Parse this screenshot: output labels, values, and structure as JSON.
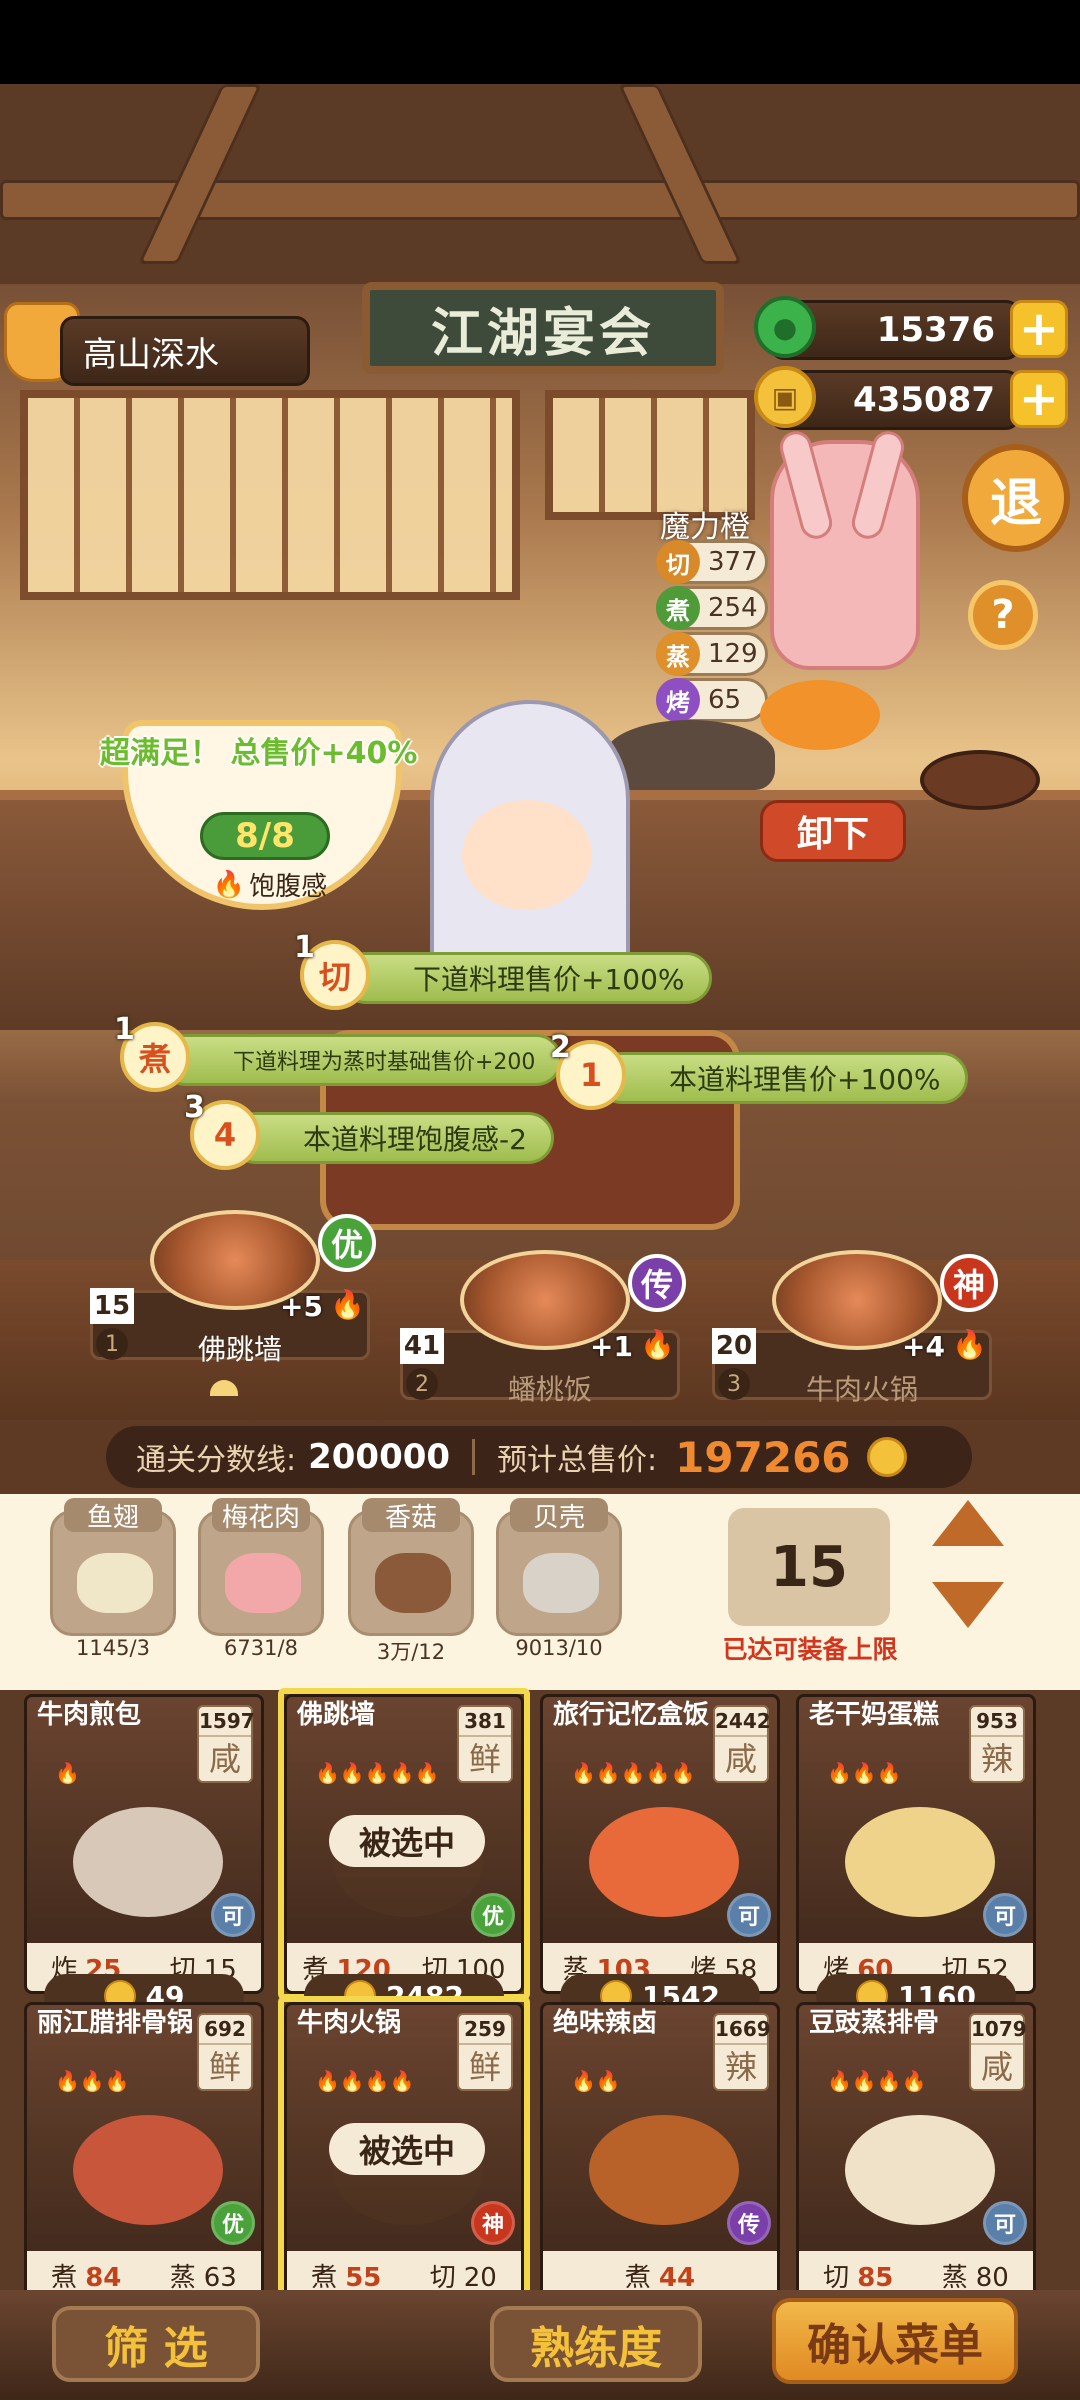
{
  "header": {
    "player_name": "高山深水",
    "sign": "江湖宴会"
  },
  "currency": {
    "jade": "15376",
    "coins": "435087",
    "plus": "+",
    "exit_label": "退",
    "help_label": "?"
  },
  "chef": {
    "name": "魔力橙",
    "skills": [
      {
        "icon": "切",
        "value": "377",
        "color": "#d88a2a"
      },
      {
        "icon": "煮",
        "value": "254",
        "color": "#4f9b3a"
      },
      {
        "icon": "蒸",
        "value": "129",
        "color": "#e0902a"
      },
      {
        "icon": "烤",
        "value": "65",
        "color": "#8e4fc2"
      }
    ],
    "unload": "卸下"
  },
  "satisfaction": {
    "text": "超满足！ 总售价+40%",
    "value": "8/8",
    "label": "饱腹感"
  },
  "buffs": [
    {
      "num": "1",
      "icon": "切",
      "text": "下道料理售价+100%"
    },
    {
      "num": "1",
      "icon": "煮",
      "text": "下道料理为蒸时基础售价+200"
    },
    {
      "num": "2",
      "icon": "1",
      "text": "本道料理售价+100%"
    },
    {
      "num": "3",
      "icon": "4",
      "text": "本道料理饱腹感-2"
    }
  ],
  "slots": [
    {
      "idx": "1",
      "name": "佛跳墙",
      "value": "15",
      "bonus": "+5",
      "rank": "优",
      "rank_color": "#4aa23a"
    },
    {
      "idx": "2",
      "name": "蟠桃饭",
      "value": "41",
      "bonus": "+1",
      "rank": "传",
      "rank_color": "#7a3fa8"
    },
    {
      "idx": "3",
      "name": "牛肉火锅",
      "value": "20",
      "bonus": "+4",
      "rank": "神",
      "rank_color": "#c8361e"
    }
  ],
  "score": {
    "pass_label": "通关分数线:",
    "pass_value": "200000",
    "expected_label": "预计总售价:",
    "expected_value": "197266"
  },
  "categories": [
    {
      "label": "鱼翅",
      "count": "1145/3"
    },
    {
      "label": "梅花肉",
      "count": "6731/8"
    },
    {
      "label": "香菇",
      "count": "3万/12"
    },
    {
      "label": "贝壳",
      "count": "9013/10"
    }
  ],
  "capacity": {
    "value": "15",
    "note": "已达可装备上限"
  },
  "dishes": [
    {
      "name": "牛肉煎包",
      "price": "1597",
      "flavor": "咸",
      "fires": "🔥",
      "tag": "可",
      "s1": "炸",
      "v1": "25",
      "s2": "切",
      "v2": "15",
      "cost": "49",
      "selected": ""
    },
    {
      "name": "佛跳墙",
      "price": "381",
      "flavor": "鲜",
      "fires": "🔥🔥🔥🔥🔥",
      "tag": "优",
      "s1": "煮",
      "v1": "120",
      "s2": "切",
      "v2": "100",
      "cost": "2482",
      "selected": "被选中"
    },
    {
      "name": "旅行记忆盒饭",
      "price": "2442",
      "flavor": "咸",
      "fires": "🔥🔥🔥🔥🔥",
      "tag": "可",
      "s1": "蒸",
      "v1": "103",
      "s2": "烤",
      "v2": "58",
      "cost": "1542",
      "selected": ""
    },
    {
      "name": "老干妈蛋糕",
      "price": "953",
      "flavor": "辣",
      "fires": "🔥🔥🔥",
      "tag": "可",
      "s1": "烤",
      "v1": "60",
      "s2": "切",
      "v2": "52",
      "cost": "1160",
      "selected": ""
    },
    {
      "name": "丽江腊排骨锅",
      "price": "692",
      "flavor": "鲜",
      "fires": "🔥🔥🔥",
      "tag": "优",
      "s1": "煮",
      "v1": "84",
      "s2": "蒸",
      "v2": "63",
      "cost": "",
      "selected": ""
    },
    {
      "name": "牛肉火锅",
      "price": "259",
      "flavor": "鲜",
      "fires": "🔥🔥🔥🔥",
      "tag": "神",
      "s1": "煮",
      "v1": "55",
      "s2": "切",
      "v2": "20",
      "cost": "",
      "selected": "被选中"
    },
    {
      "name": "绝味辣卤",
      "price": "1669",
      "flavor": "辣",
      "fires": "🔥🔥",
      "tag": "传",
      "s1": "煮",
      "v1": "44",
      "s2": "",
      "v2": "",
      "cost": "",
      "selected": ""
    },
    {
      "name": "豆豉蒸排骨",
      "price": "1079",
      "flavor": "咸",
      "fires": "🔥🔥🔥🔥",
      "tag": "可",
      "s1": "切",
      "v1": "85",
      "s2": "蒸",
      "v2": "80",
      "cost": "",
      "selected": ""
    }
  ],
  "footer": {
    "filter": "筛 选",
    "proficiency": "熟练度",
    "confirm": "确认菜单"
  }
}
